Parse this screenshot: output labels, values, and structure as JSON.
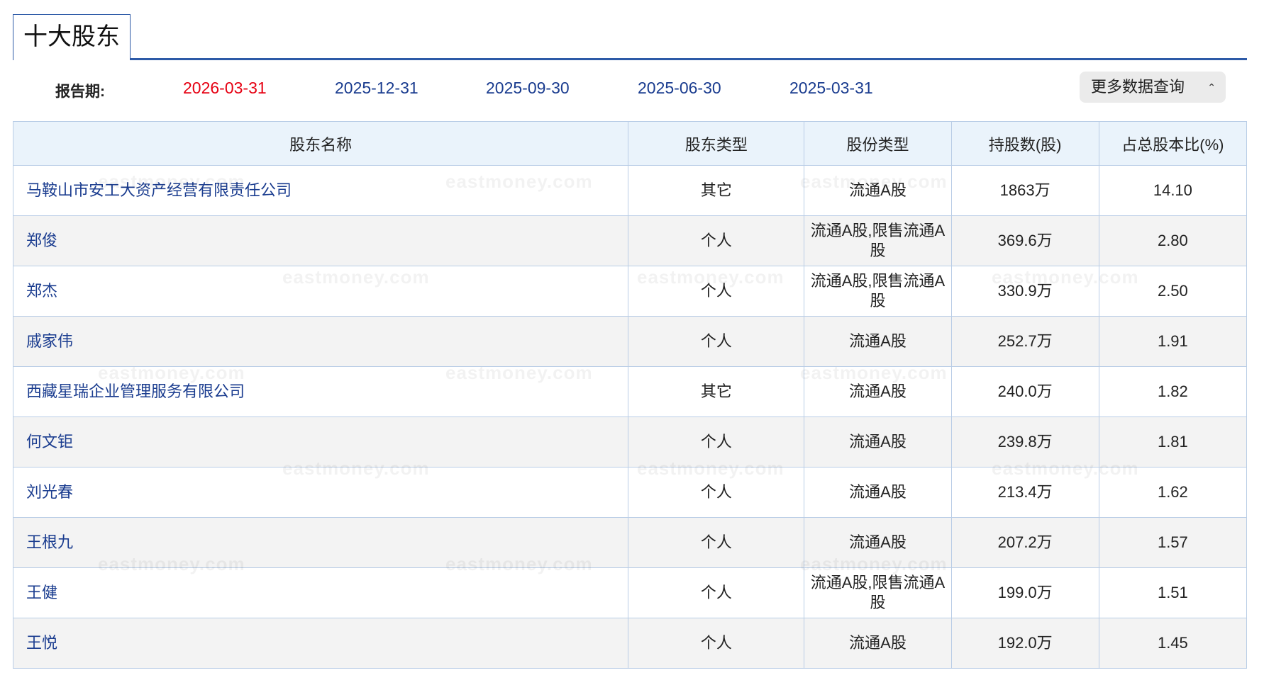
{
  "section": {
    "title": "十大股东"
  },
  "period": {
    "label": "报告期:",
    "dates": [
      "2026-03-31",
      "2025-12-31",
      "2025-09-30",
      "2025-06-30",
      "2025-03-31"
    ],
    "active_index": 0,
    "more_button": "更多数据查询"
  },
  "table": {
    "headers": [
      "股东名称",
      "股东类型",
      "股份类型",
      "持股数(股)",
      "占总股本比(%)"
    ],
    "rows": [
      [
        "马鞍山市安工大资产经营有限责任公司",
        "其它",
        "流通A股",
        "1863万",
        "14.10"
      ],
      [
        "郑俊",
        "个人",
        "流通A股,限售流通A股",
        "369.6万",
        "2.80"
      ],
      [
        "郑杰",
        "个人",
        "流通A股,限售流通A股",
        "330.9万",
        "2.50"
      ],
      [
        "戚家伟",
        "个人",
        "流通A股",
        "252.7万",
        "1.91"
      ],
      [
        "西藏星瑞企业管理服务有限公司",
        "其它",
        "流通A股",
        "240.0万",
        "1.82"
      ],
      [
        "何文钜",
        "个人",
        "流通A股",
        "239.8万",
        "1.81"
      ],
      [
        "刘光春",
        "个人",
        "流通A股",
        "213.4万",
        "1.62"
      ],
      [
        "王根九",
        "个人",
        "流通A股",
        "207.2万",
        "1.57"
      ],
      [
        "王健",
        "个人",
        "流通A股,限售流通A股",
        "199.0万",
        "1.51"
      ],
      [
        "王悦",
        "个人",
        "流通A股",
        "192.0万",
        "1.45"
      ]
    ]
  },
  "watermark": "eastmoney.com",
  "colors": {
    "accent": "#2d5aa7",
    "link": "#1a3c8f",
    "active": "#e60012",
    "header_bg": "#eaf3fb"
  },
  "icons": {
    "more_button": "chevron-up-down-icon"
  }
}
